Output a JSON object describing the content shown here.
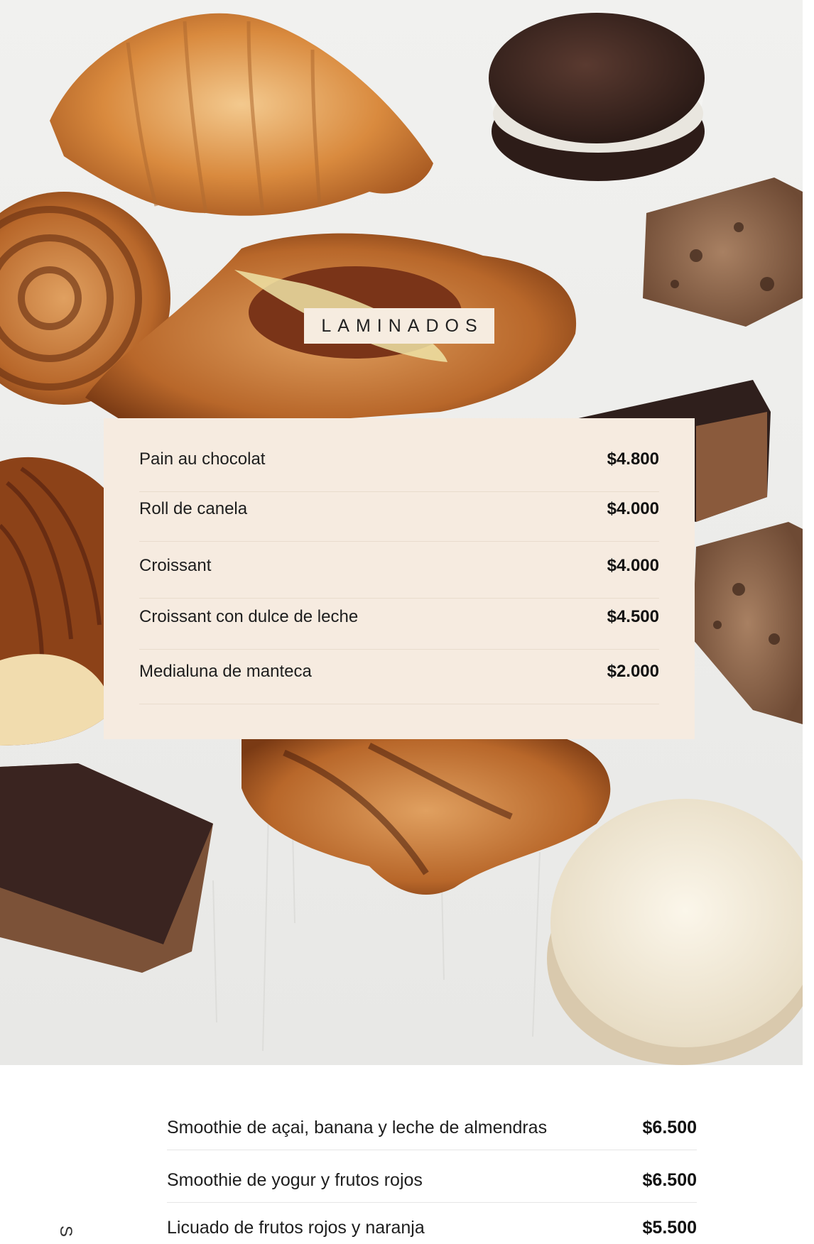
{
  "section": {
    "title": "LAMINADOS"
  },
  "laminados": {
    "items": [
      {
        "name": "Pain au chocolat",
        "price": "$4.800"
      },
      {
        "name": "Roll de canela",
        "price": "$4.000"
      },
      {
        "name": "Croissant",
        "price": "$4.000"
      },
      {
        "name": "Croissant con dulce de leche",
        "price": "$4.500"
      },
      {
        "name": "Medialuna de manteca",
        "price": "$2.000"
      }
    ]
  },
  "drinks": {
    "items": [
      {
        "name": "Smoothie de açai, banana y leche de almendras",
        "price": "$6.500"
      },
      {
        "name": "Smoothie de yogur y frutos rojos",
        "price": "$6.500"
      },
      {
        "name": "Licuado de frutos rojos y naranja",
        "price": "$5.500"
      }
    ],
    "side_letter": "S"
  },
  "colors": {
    "card_background": "#f6ebe0",
    "label_background": "#f6ece0",
    "text": "#1e1e1e",
    "pastry": "#c8783a",
    "chocolate": "#3a2620"
  },
  "image": {
    "description_icon": "pastry-photo"
  }
}
